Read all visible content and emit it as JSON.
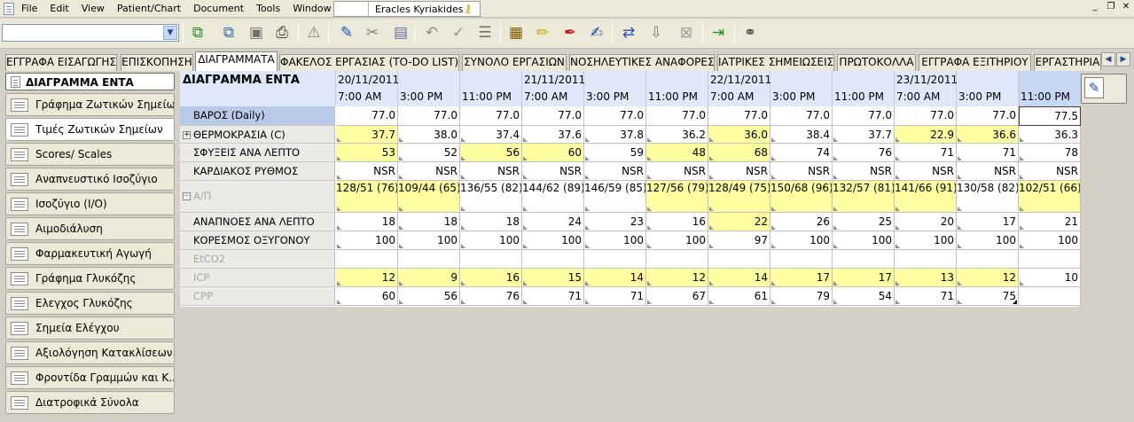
{
  "menu": {
    "items": [
      "File",
      "Edit",
      "View",
      "Patient/Chart",
      "Document",
      "Tools",
      "Window",
      "Help"
    ],
    "user": "Eracles Kyriakides"
  },
  "window_controls": [
    "_",
    "❐",
    "✕"
  ],
  "toolbar": {
    "combo_value": "",
    "icons": [
      "chart-add-icon",
      "chart-copy-icon",
      "save-icon",
      "print-icon",
      "alert-icon",
      "edit-check-icon",
      "cut-icon",
      "paste-icon",
      "undo-icon",
      "check-icon",
      "checklist-icon",
      "calendar-icon",
      "highlight-icon",
      "signature-icon",
      "note-icon",
      "transfer-icon",
      "import-icon",
      "lock-icon",
      "export-icon",
      "link-icon"
    ]
  },
  "tabs": [
    "ΕΓΓΡΑΦΑ ΕΙΣΑΓΩΓΗΣ",
    "ΕΠΙΣΚΟΠΗΣΗ",
    "ΔΙΑΓΡΑΜΜΑΤΑ",
    "ΦΑΚΕΛΟΣ ΕΡΓΑΣΙΑΣ (TO-DO LIST)",
    "ΣΥΝΟΛΟ ΕΡΓΑΣΙΩΝ",
    "ΝΟΣΗΛΕΥΤΙΚΕΣ ΑΝΑΦΟΡΕΣ",
    "ΙΑΤΡΙΚΕΣ ΣΗΜΕΙΩΣΕΙΣ",
    "ΠΡΩΤΟΚΟΛΛΑ",
    "ΕΓΓΡΑΦΑ ΕΞΙΤΗΡΙΟΥ",
    "ΕΡΓΑΣΤΗΡΙΑ"
  ],
  "active_tab": "ΔΙΑΓΡΑΜΜΑΤΑ",
  "sidebar": {
    "header": "ΔΙΑΓΡΑΜΜΑ ΕΝΤΑ",
    "items": [
      "Γράφημα Ζωτικών Σημείων",
      "Τιμές Ζωτικών Σημείων",
      "Scores/ Scales",
      "Αναπνευστικό Ισοζύγιο",
      "Ισοζύγιο (I/O)",
      "Αιμοδιάλυση",
      "Φαρμακευτική Αγωγή",
      "Γράφημα Γλυκόζης",
      "Ελεγχος Γλυκόζης",
      "Σημεία Ελέγχου",
      "Αξιολόγηση Κατακλίσεων...",
      "Φροντίδα Γραμμών και Κ...",
      "Διατροφικά Σύνολα"
    ],
    "selected": "Τιμές Ζωτικών Σημείων"
  },
  "grid": {
    "title": "ΔΙΑΓΡΑΜΜΑ ΕΝΤΑ",
    "columns": [
      {
        "date": "20/11/2011",
        "time": "7:00 AM"
      },
      {
        "date": "",
        "time": "3:00 PM"
      },
      {
        "date": "",
        "time": "11:00 PM"
      },
      {
        "date": "21/11/2011",
        "time": "7:00 AM"
      },
      {
        "date": "",
        "time": "3:00 PM"
      },
      {
        "date": "",
        "time": "11:00 PM"
      },
      {
        "date": "22/11/2011",
        "time": "7:00 AM"
      },
      {
        "date": "",
        "time": "3:00 PM"
      },
      {
        "date": "",
        "time": "11:00 PM"
      },
      {
        "date": "23/11/2011",
        "time": "7:00 AM"
      },
      {
        "date": "",
        "time": "3:00 PM"
      },
      {
        "date": "",
        "time": "11:00 PM"
      }
    ],
    "rows": [
      {
        "label": "ΒΑΡΟΣ (Daily)",
        "values": [
          "77.0",
          "77.0",
          "77.0",
          "77.0",
          "77.0",
          "77.0",
          "77.0",
          "77.0",
          "77.0",
          "77.0",
          "77.0",
          "77.5"
        ],
        "yellow": [],
        "dim": false,
        "expand": false,
        "selected": true
      },
      {
        "label": "ΘΕΡΜΟΚΡΑΣΙΑ (C)",
        "values": [
          "37.7",
          "38.0",
          "37.4",
          "37.6",
          "37.8",
          "36.2",
          "36.0",
          "38.4",
          "37.7",
          "22.9",
          "36.6",
          "36.3"
        ],
        "yellow": [
          0,
          6,
          9,
          10
        ],
        "dim": false,
        "expand": true,
        "selected": false
      },
      {
        "label": "ΣΦΥΞΕΙΣ ΑΝΑ ΛΕΠΤΟ",
        "values": [
          "53",
          "52",
          "56",
          "60",
          "59",
          "48",
          "68",
          "74",
          "76",
          "71",
          "71",
          "78"
        ],
        "yellow": [
          0,
          2,
          3,
          5,
          6
        ],
        "dim": false,
        "expand": false,
        "selected": false
      },
      {
        "label": "ΚΑΡΔΙΑΚΟΣ ΡΥΘΜΟΣ",
        "values": [
          "NSR",
          "NSR",
          "NSR",
          "NSR",
          "NSR",
          "NSR",
          "NSR",
          "NSR",
          "NSR",
          "NSR",
          "NSR",
          "NSR"
        ],
        "yellow": [],
        "dim": false,
        "expand": false,
        "selected": false
      },
      {
        "label": "Α/Π",
        "values": [
          "128/51 (76)",
          "109/44 (65)",
          "136/55 (82)",
          "144/62 (89)",
          "146/59 (85)",
          "127/56 (79)",
          "128/49 (75)",
          "150/68 (96)",
          "132/57 (81)",
          "141/66 (91)",
          "130/58 (82)",
          "102/51 (66)"
        ],
        "yellow": [
          0,
          1,
          5,
          6,
          7,
          8,
          9,
          11
        ],
        "dim": true,
        "expand": true,
        "selected": false
      },
      {
        "label": "ΑΝΑΠΝΟΕΣ ΑΝΑ ΛΕΠΤΟ",
        "values": [
          "18",
          "18",
          "18",
          "24",
          "23",
          "16",
          "22",
          "26",
          "25",
          "20",
          "17",
          "21"
        ],
        "yellow": [
          6
        ],
        "dim": false,
        "expand": false,
        "selected": false
      },
      {
        "label": "ΚΟΡΕΣΜΟΣ ΟΞΥΓΟΝΟΥ",
        "values": [
          "100",
          "100",
          "100",
          "100",
          "100",
          "100",
          "97",
          "100",
          "100",
          "100",
          "100",
          "100"
        ],
        "yellow": [],
        "dim": false,
        "expand": false,
        "selected": false
      },
      {
        "label": "EtCO2",
        "values": [
          "",
          "",
          "",
          "",
          "",
          "",
          "",
          "",
          "",
          "",
          "",
          ""
        ],
        "yellow": [],
        "dim": true,
        "expand": false,
        "selected": false
      },
      {
        "label": "ICP",
        "values": [
          "12",
          "9",
          "16",
          "15",
          "14",
          "12",
          "14",
          "17",
          "17",
          "13",
          "12",
          "10"
        ],
        "yellow": [
          0,
          1,
          2,
          3,
          4,
          5,
          6,
          7,
          8,
          9,
          10
        ],
        "dim": true,
        "expand": false,
        "selected": false
      },
      {
        "label": "CPP",
        "values": [
          "60",
          "56",
          "76",
          "71",
          "71",
          "67",
          "61",
          "79",
          "54",
          "71",
          "75",
          ""
        ],
        "yellow": [],
        "dim": true,
        "expand": false,
        "selected": false
      }
    ]
  }
}
